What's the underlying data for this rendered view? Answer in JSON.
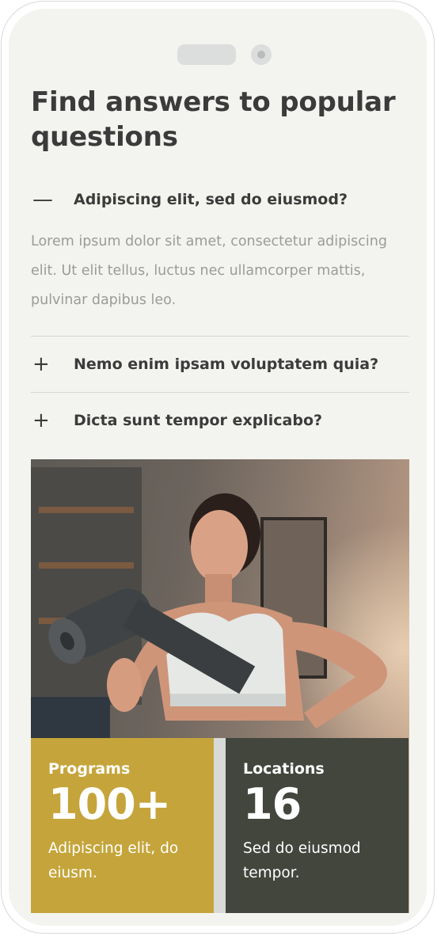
{
  "heading": "Find answers to popular questions",
  "faq": [
    {
      "toggle": "—",
      "question": "Adipiscing elit, sed do eiusmod?",
      "answer": "Lorem ipsum dolor sit amet, consectetur adipiscing elit. Ut elit tellus, luctus nec ullamcorper mattis, pulvinar dapibus leo.",
      "expanded": true
    },
    {
      "toggle": "+",
      "question": "Nemo enim ipsam voluptatem quia?",
      "expanded": false
    },
    {
      "toggle": "+",
      "question": "Dicta sunt tempor explicabo?",
      "expanded": false
    }
  ],
  "hero_image": "woman-with-yoga-mat-photo",
  "stats": [
    {
      "label": "Programs",
      "value": "100+",
      "description": "Adipiscing elit, do eiusm.",
      "color": "#c5a53b"
    },
    {
      "label": "Locations",
      "value": "16",
      "description": "Sed do eiusmod tempor.",
      "color": "#42463d"
    }
  ],
  "colors": {
    "background": "#f3f4ef",
    "heading": "#3b3b3b",
    "answer_text": "#9b9b98",
    "accent_gold": "#c5a53b",
    "accent_dark": "#42463d"
  }
}
